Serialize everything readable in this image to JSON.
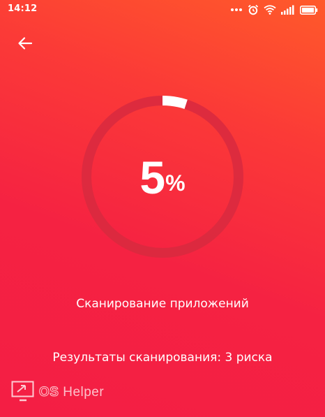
{
  "status_bar": {
    "time": "14:12",
    "icons": [
      "more-dots-icon",
      "alarm-icon",
      "wifi-icon",
      "signal-icon",
      "battery-icon"
    ]
  },
  "toolbar": {
    "back_icon": "arrow-left-icon"
  },
  "progress": {
    "value": 5,
    "number": "5",
    "unit": "%"
  },
  "scan": {
    "status": "Сканирование приложений",
    "results": "Результаты сканирования: 3 риска"
  },
  "watermark": {
    "os": "OS",
    "helper": "Helper"
  },
  "colors": {
    "background_top": "#ff5a2a",
    "background_bottom": "#f41e44",
    "ring_track": "#db2a3e",
    "ring_progress": "#ffffff"
  }
}
